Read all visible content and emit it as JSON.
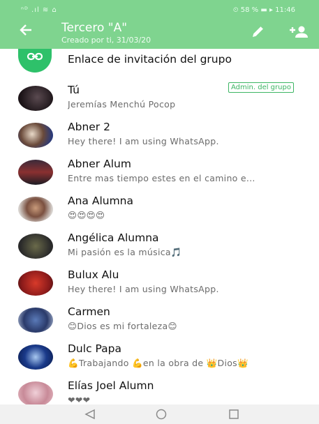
{
  "status_bar": {
    "left": "ⁿᴰ .ıl ≋ ⌂",
    "right": "⏲ 58 % ▬ ▸ 11:46"
  },
  "header": {
    "title": "Tercero \"A\"",
    "subtitle": "Creado por ti, 31/03/20",
    "back_icon": "arrow-left-icon",
    "edit_icon": "pencil-icon",
    "add_icon": "add-person-icon"
  },
  "invite": {
    "label": "Enlace de invitación del grupo",
    "icon": "link-icon"
  },
  "participants": [
    {
      "name": "Tú",
      "status": "Jeremías Menchú Pocop",
      "badge": "Admin. del grupo"
    },
    {
      "name": "Abner 2",
      "status": "Hey there! I am using WhatsApp."
    },
    {
      "name": "Abner Alum",
      "status": "Entre mas  tiempo estes en el camino e..."
    },
    {
      "name": "Ana Alumna",
      "status": "😍😍😍😍"
    },
    {
      "name": "Angélica Alumna",
      "status": "Mi pasión es la música🎵"
    },
    {
      "name": "Bulux Alu",
      "status": "Hey there! I am using WhatsApp."
    },
    {
      "name": "Carmen",
      "status": "😊Dios es mi fortaleza😊"
    },
    {
      "name": "Dulc Papa",
      "status": "💪Trabajando 💪en la obra de 👑Dios👑"
    },
    {
      "name": "Elías Joel Alumn",
      "status": "❤❤❤"
    }
  ],
  "nav": {
    "back": "triangle-back-icon",
    "home": "circle-home-icon",
    "recent": "square-recent-icon"
  },
  "colors": {
    "header": "#7fd48f",
    "accent": "#2ec16a",
    "badge": "#3cb563"
  }
}
